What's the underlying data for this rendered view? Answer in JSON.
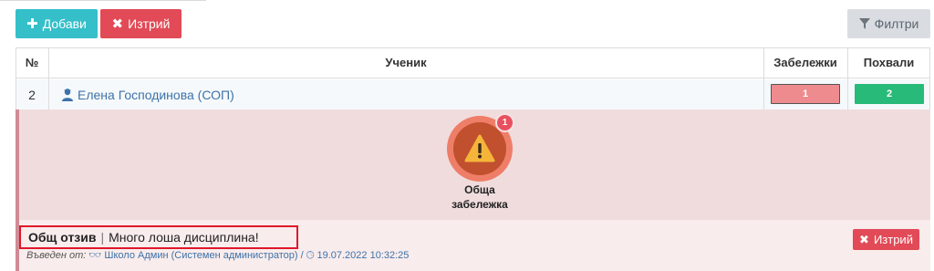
{
  "toolbar": {
    "add_label": "Добави",
    "delete_label": "Изтрий",
    "filter_label": "Филтри"
  },
  "table": {
    "headers": {
      "num": "№",
      "student": "Ученик",
      "remarks": "Забележки",
      "praises": "Похвали"
    },
    "rows": [
      {
        "num": "2",
        "student": "Елена Господинова (СОП)",
        "remarks": "1",
        "praises": "2"
      }
    ]
  },
  "detail": {
    "category_count": "1",
    "category_label_line1": "Обща",
    "category_label_line2": "забележка"
  },
  "note": {
    "type": "Общ отзив",
    "separator": "|",
    "text": "Много лоша дисциплина!",
    "entered_by_label": "Въведен от:",
    "author": "Школо Админ (Системен администратор)",
    "slash": "/",
    "datetime": "19.07.2022 10:32:25",
    "delete_label": "Изтрий"
  },
  "colors": {
    "add_button": "#34bfc9",
    "delete_button": "#e14a56",
    "praise_badge": "#28ba78",
    "remark_badge": "#ee8b8e",
    "panel_bg": "#f0dcdd",
    "link": "#3d72a9"
  }
}
